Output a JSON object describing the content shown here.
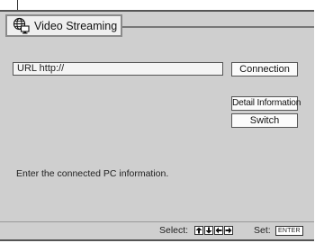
{
  "title": {
    "label": "Video Streaming",
    "icon": "globe-monitor-icon"
  },
  "url_field": {
    "value": "URL  http://"
  },
  "buttons": {
    "connection": "Connection",
    "detail_information": "Detail Information",
    "switch": "Switch"
  },
  "message": "Enter the connected PC information.",
  "status_bar": {
    "select_label": "Select:",
    "select_keys": [
      "up-arrow-key-icon",
      "down-arrow-key-icon",
      "left-arrow-key-icon",
      "right-arrow-key-icon"
    ],
    "set_label": "Set:",
    "enter_key": "ENTER"
  }
}
